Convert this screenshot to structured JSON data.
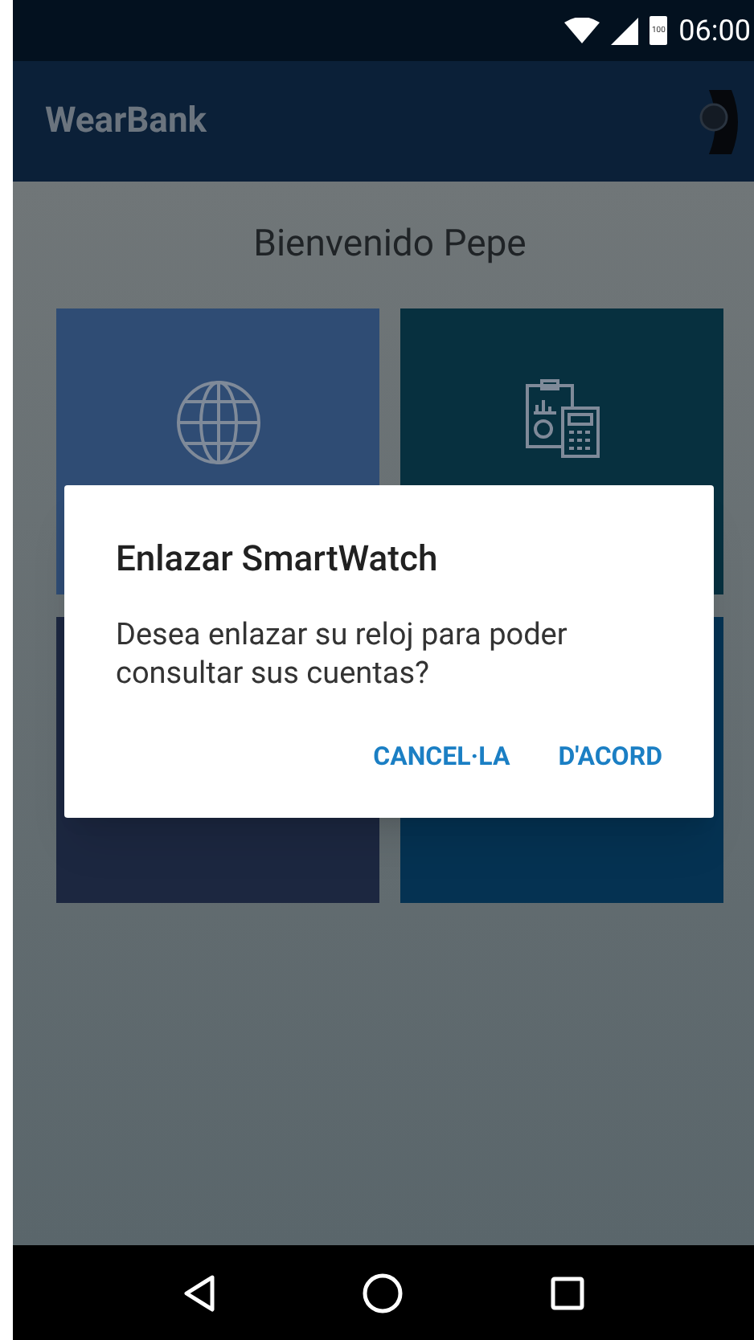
{
  "status_bar": {
    "battery_label": "100",
    "time": "06:00"
  },
  "app_bar": {
    "title": "WearBank"
  },
  "welcome": "Bienvenido Pepe",
  "tiles": [
    {
      "kind": "globe",
      "color": "#2f4c74"
    },
    {
      "kind": "report",
      "color": "#07303f"
    },
    {
      "color": "#1c2740"
    },
    {
      "color": "#053252"
    }
  ],
  "dialog": {
    "title": "Enlazar SmartWatch",
    "message": "Desea enlazar su reloj para poder consultar sus cuentas?",
    "buttons": [
      "CANCEL·LA",
      "D'ACORD"
    ]
  }
}
